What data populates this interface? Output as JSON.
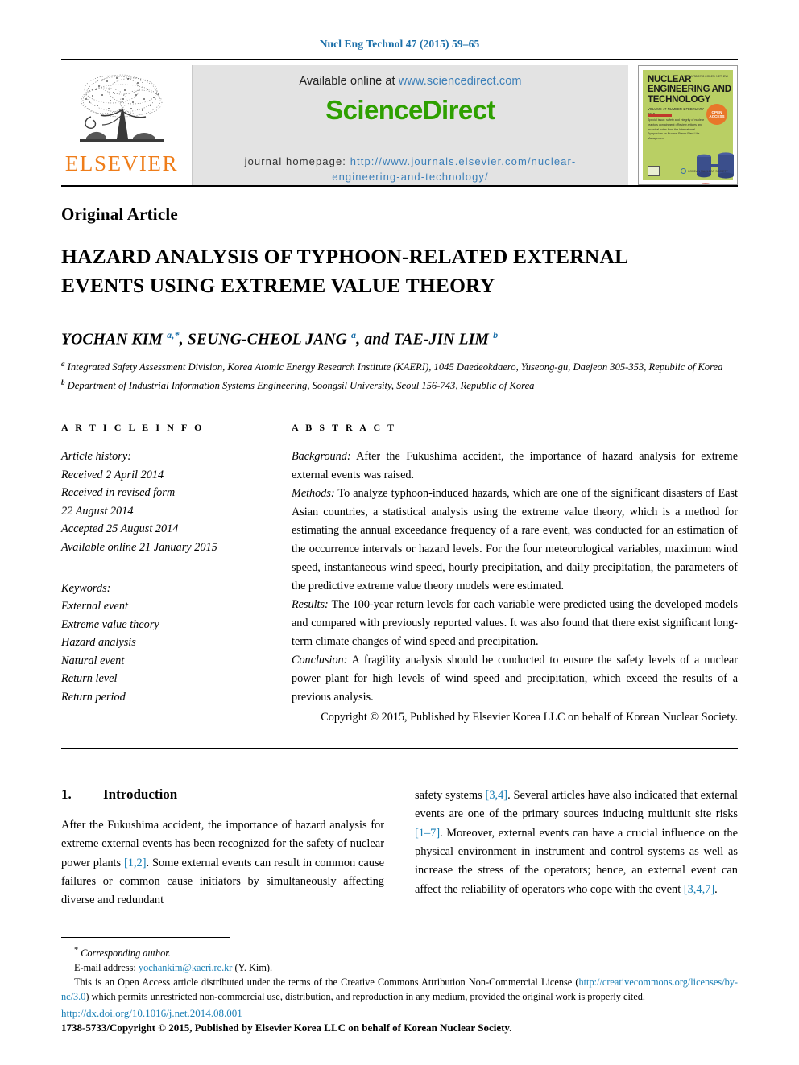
{
  "running_head": "Nucl Eng Technol 47 (2015) 59–65",
  "publisher": {
    "logo_word": "ELSEVIER",
    "logo_icon": "elsevier-tree-icon",
    "accent_color": "#ef7d1a"
  },
  "banner": {
    "available_prefix": "Available online at ",
    "available_link": "www.sciencedirect.com",
    "sciencedirect_logo": "ScienceDirect",
    "sciencedirect_color": "#2ea000",
    "homepage_label": "journal homepage:",
    "homepage_url_line1": "http://www.journals.elsevier.com/nuclear-",
    "homepage_url_line2": "engineering-and-technology/",
    "background": "#e3e3e3"
  },
  "cover": {
    "title_line1": "NUCLEAR",
    "title_line2": "ENGINEERING AND",
    "title_line3": "TECHNOLOGY",
    "volume_line": "VOLUME 47  NUMBER 1  FEBRUARY 2015",
    "issn_block": "ISSN 1738-5733\nCODEN: NETHEW",
    "special_tag": "SPECIAL",
    "abstract_blurb": "Special issue: safety and integrity of nuclear reactors containment  •  Review articles and technical notes from the International Symposium on Nuclear Power Plant Life Management",
    "badge_text": "OPEN ACCESS",
    "badge_color": "#e8772a",
    "background": "#b9cf64",
    "artwork_icon": "reactor-vessel-diagram-icon",
    "footer_left_icon": "elsevier-mark-icon",
    "footer_right_label": "KOREAN NUCLEAR SOCIETY"
  },
  "article_type": "Original Article",
  "title": "HAZARD ANALYSIS OF TYPHOON-RELATED EXTERNAL EVENTS USING EXTREME VALUE THEORY",
  "authors_html": "YOCHAN KIM <sup>a,*</sup>, SEUNG-CHEOL JANG <sup>a</sup>, and TAE-JIN LIM <sup>b</sup>",
  "affiliations": [
    "a Integrated Safety Assessment Division, Korea Atomic Energy Research Institute (KAERI), 1045 Daedeokdaero, Yuseong-gu, Daejeon 305-353, Republic of Korea",
    "b Department of Industrial Information Systems Engineering, Soongsil University, Seoul 156-743, Republic of Korea"
  ],
  "article_info": {
    "heading": "A R T I C L E   I N F O",
    "history_label": "Article history:",
    "history": [
      "Received 2 April 2014",
      "Received in revised form",
      "22 August 2014",
      "Accepted 25 August 2014",
      "Available online 21 January 2015"
    ],
    "keywords_label": "Keywords:",
    "keywords": [
      "External event",
      "Extreme value theory",
      "Hazard analysis",
      "Natural event",
      "Return level",
      "Return period"
    ]
  },
  "abstract": {
    "heading": "A B S T R A C T",
    "background_label": "Background:",
    "background_text": " After the Fukushima accident, the importance of hazard analysis for extreme external events was raised.",
    "methods_label": "Methods:",
    "methods_text": " To analyze typhoon-induced hazards, which are one of the significant disasters of East Asian countries, a statistical analysis using the extreme value theory, which is a method for estimating the annual exceedance frequency of a rare event, was conducted for an estimation of the occurrence intervals or hazard levels. For the four meteorological variables, maximum wind speed, instantaneous wind speed, hourly precipitation, and daily precipitation, the parameters of the predictive extreme value theory models were estimated.",
    "results_label": "Results:",
    "results_text": " The 100-year return levels for each variable were predicted using the developed models and compared with previously reported values. It was also found that there exist significant long-term climate changes of wind speed and precipitation.",
    "conclusion_label": "Conclusion:",
    "conclusion_text": " A fragility analysis should be conducted to ensure the safety levels of a nuclear power plant for high levels of wind speed and precipitation, which exceed the results of a previous analysis.",
    "copyright": "Copyright © 2015, Published by Elsevier Korea LLC on behalf of Korean Nuclear Society."
  },
  "introduction": {
    "number": "1.",
    "heading": "Introduction",
    "left_text_parts": [
      "After the Fukushima accident, the importance of hazard analysis for extreme external events has been recognized for the safety of nuclear power plants ",
      "[1,2]",
      ". Some external events can result in common cause failures or common cause initiators by simultaneously affecting diverse and redundant "
    ],
    "right_text_parts": [
      "safety systems ",
      "[3,4]",
      ". Several articles have also indicated that external events are one of the primary sources inducing multiunit site risks ",
      "[1–7]",
      ". Moreover, external events can have a crucial influence on the physical environment in instrument and control systems as well as increase the stress of the operators; hence, an external event can affect the reliability of operators who cope with the event ",
      "[3,4,7]",
      "."
    ]
  },
  "footnotes": {
    "corresponding_marker": "*",
    "corresponding_label": "Corresponding author.",
    "email_label": "E-mail address:",
    "email_link": "yochankim@kaeri.re.kr",
    "email_suffix": "(Y. Kim).",
    "license_text_1": "This is an Open Access article distributed under the terms of the Creative Commons Attribution Non-Commercial License (",
    "license_link_1": "http://",
    "license_link_2": "creativecommons.org/licenses/by-nc/3.0",
    "license_text_2": ") which permits unrestricted non-commercial use, distribution, and reproduction in any medium, provided the original work is properly cited.",
    "doi": "http://dx.doi.org/10.1016/j.net.2014.08.001",
    "issn_copyright": "1738-5733/Copyright © 2015, Published by Elsevier Korea LLC on behalf of Korean Nuclear Society."
  },
  "colors": {
    "link_blue": "#1a7fb5",
    "header_blue": "#1a6ea8",
    "elsevier_orange": "#ef7d1a",
    "sciencedirect_green": "#2ea000"
  }
}
